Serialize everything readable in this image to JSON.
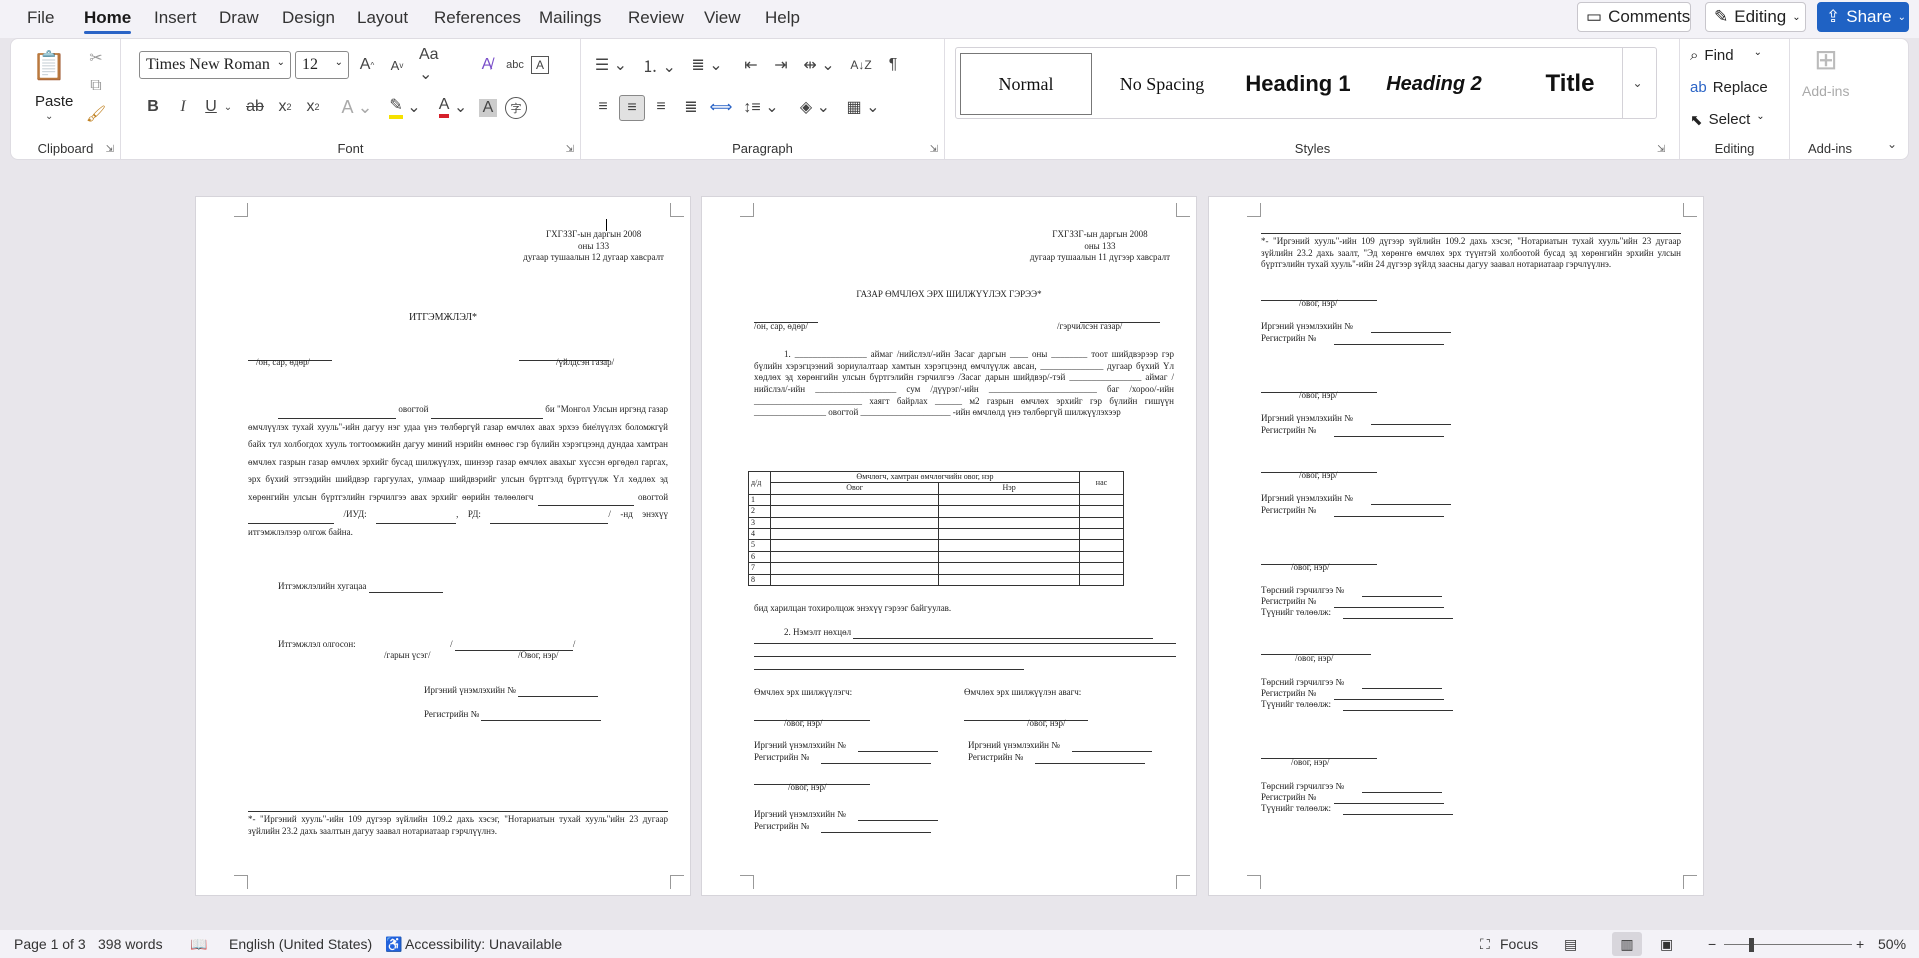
{
  "menu": {
    "items": [
      "File",
      "Home",
      "Insert",
      "Draw",
      "Design",
      "Layout",
      "References",
      "Mailings",
      "Review",
      "View",
      "Help"
    ],
    "comments": "Comments",
    "editing": "Editing",
    "share": "Share"
  },
  "ribbon": {
    "clipboard": {
      "label": "Clipboard",
      "paste": "Paste"
    },
    "font": {
      "label": "Font",
      "name": "Times New Roman",
      "size": "12"
    },
    "paragraph": {
      "label": "Paragraph"
    },
    "styles": {
      "label": "Styles",
      "items": [
        "Normal",
        "No Spacing",
        "Heading 1",
        "Heading 2",
        "Title"
      ]
    },
    "editing": {
      "label": "Editing",
      "find": "Find",
      "replace": "Replace",
      "select": "Select"
    },
    "addins": {
      "label": "Add-ins",
      "btn": "Add-ins"
    }
  },
  "page1": {
    "hdr": [
      "ГХГЗЗГ-ын даргын 2008",
      "оны 133",
      "дугаар тушаалын 12 дугаар хавсралт"
    ],
    "title": "ИТГЭМЖЛЭЛ*",
    "date_lbl": "/он, сар, өдөр/",
    "place_lbl": "/үйлдсэн газар/",
    "body_a": "овогтой",
    "body_b": "би \"Монгол Улсын иргэнд газар өмчлүүлэх тухай хууль\"-ийн дагуу нэг удаа үнэ төлбөргүй газар өмчлөх авах эрхээ бие̇лүүлэх боломжгүй байх тул холбогдох хууль тогтоомжийн дагуу миний нэрийн өмнөөс гэр бүлийн хэрэгцээнд дундаа хамтран өмчлөх газрын газар өмчлөх эрхийг бусад шилжүүлэх, шинээр газар өмчлөх авахыг хүссэн өргөдөл гаргах, эрх бүхий этгээдийн шийдвэр гаргуулах, улмаар шийдвэрийг улсын бүртгэлд бүртгүүлж Үл хөдлөх эд хөрөнгийн улсын бүртгэлийн гэрчилгээ авах эрхийг өөрийн төлөөлөгч",
    "body_c": "овогтой",
    "body_d": "/ИУД:",
    "body_e": "РД:",
    "body_f": "/ -нд энэхүү итгэмжлэлээр олгож байна.",
    "valid": "Итгэмжлэлийн хугацаа",
    "issuer": "Итгэмжлэл олгосон:",
    "sig": "/гарын үсэг/",
    "name": "/Овог, нэр/",
    "id": "Иргэний үнэмлэхийн №",
    "reg": "Регистрийн №",
    "foot": "*- \"Иргэний хууль\"-ийн 109 дүгээр зүйлийн 109.2 дахь хэсэг, \"Нотариатын тухай хууль\"ийн 23 дугаар зүйлийн 23.2 дахь заалтын дагуу заавал нотариатаар гэрчлүүлнэ."
  },
  "page2": {
    "hdr": [
      "ГХГЗЗГ-ын даргын 2008",
      "оны 133",
      "дугаар тушаалын 11 дүгээр хавсралт"
    ],
    "title": "ГАЗАР ӨМЧЛӨХ ЭРХ ШИЛЖҮҮЛЭХ ГЭРЭЭ*",
    "date_lbl": "/он, сар, өдөр/",
    "place_lbl": "/гэрчилсэн газар/",
    "p1": "1. ________________ аймаг /нийслэл/-ийн Засаг даргын ____ оны ________ тоот шийдвэрээр гэр бүлийн хэрэгцээний зориулалтаар хамтын хэрэгцээнд өмчлүүлж авсан, ______________ дугаар бүхий Үл хөдлөх эд хөрөнгийн улсын бүртгэлийн гэрчилгээ /Засаг дарын шийдвэр/-тэй ________________ аймаг /нийслэл/-ийн __________________ сум /дүүрэг/-ийн ________________________ баг /хороо/-ийн ________________________ хаягт байрлах ______ м2 газрын өмчлөх эрхийг гэр бүлийн гишүүн ________________ овогтой ____________________ -ийн өмчлөлд үнэ төлбөргүй шилжүүлэхээр",
    "th_no": "д/д",
    "th_owners": "Өмчлөгч, хамтран өмчлөгчийн овог, нэр",
    "th_age": "нас",
    "th_last": "Овог",
    "th_first": "Нэр",
    "rows": [
      "1",
      "2",
      "3",
      "4",
      "5",
      "6",
      "7",
      "8"
    ],
    "agree": "бид харилцан тохиролцож энэхүү гэрээг байгуулав.",
    "other": "2. Нэмэлт нөхцөл",
    "from": "Өмчлөх эрх шилжүүлэгч:",
    "to": "Өмчлөх эрх шилжүүлэн авагч:",
    "name": "/овог, нэр/",
    "id": "Иргэний үнэмлэхийн №",
    "reg": "Регистрийн №"
  },
  "page3": {
    "foot": "*- \"Иргэний хууль\"-ийн 109 дүгээр зүйлийн 109.2 дахь хэсэг, \"Нотариатын тухай хууль\"ийн 23 дугаар зүйлийн 23.2 дахь заалт, \"Эд хөрөнгө өмчлөх эрх түүнтэй холбоотой бусад эд хөрөнгийн эрхийн улсын бүртгэлийн тухай хууль\"-ийн 24 дүгээр зүйлд заасны дагуу заавал нотариатаар гэрчлүүлнэ.",
    "name": "/овог, нэр/",
    "id": "Иргэний үнэмлэхийн №",
    "reg": "Регистрийн №",
    "cert": "Төрсний гэрчилгээ №",
    "rep": "Түүнийг төлөөлж:"
  },
  "status": {
    "page": "Page 1 of 3",
    "words": "398 words",
    "lang": "English (United States)",
    "access": "Accessibility: Unavailable",
    "focus": "Focus",
    "zoom": "50%"
  }
}
